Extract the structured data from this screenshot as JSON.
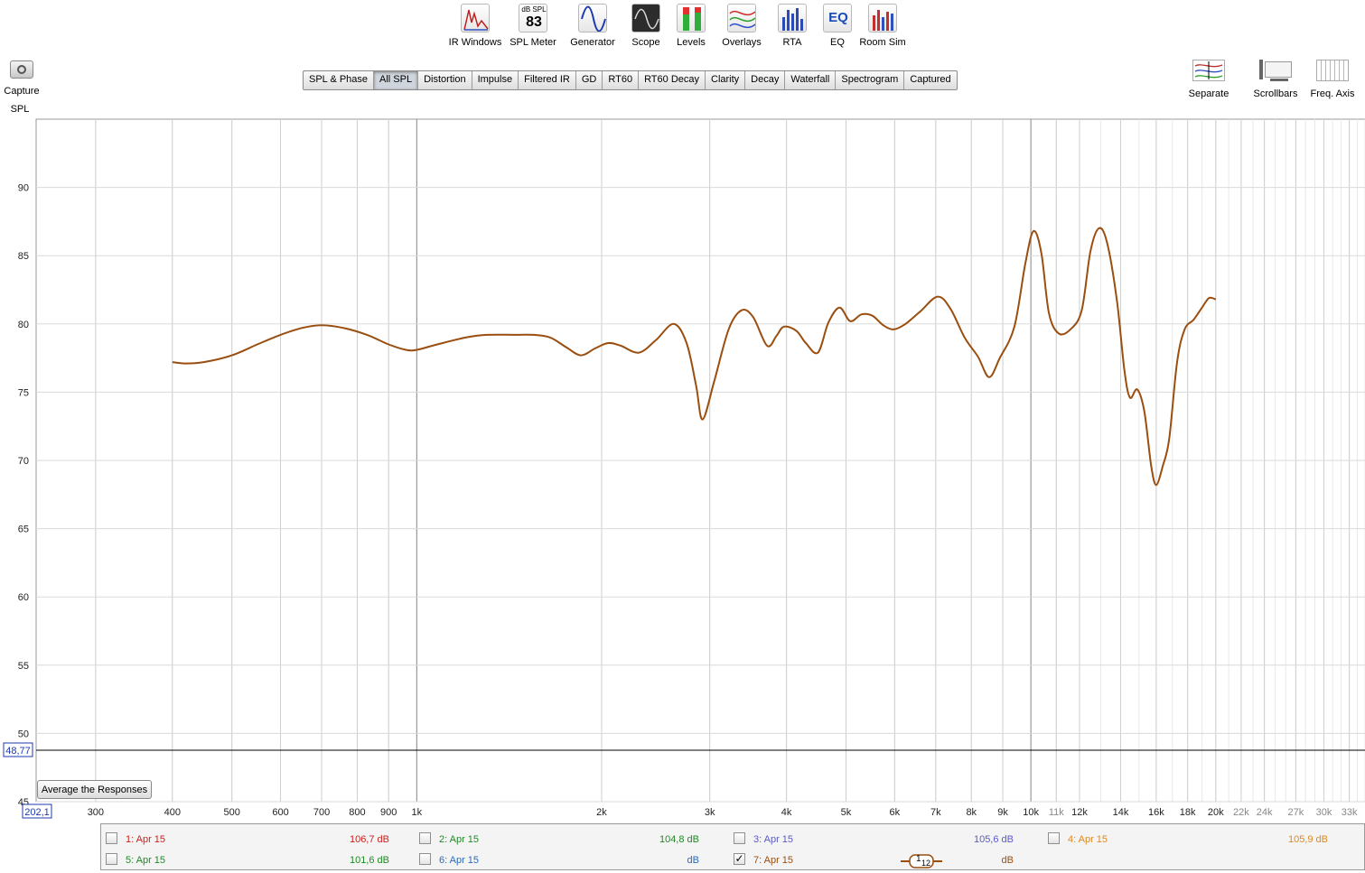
{
  "toolbar": {
    "items": [
      {
        "label": "IR Windows",
        "icon": "ir-windows-icon"
      },
      {
        "label": "SPL Meter",
        "icon": "spl-meter-icon",
        "meter_unit": "dB SPL",
        "meter_value": "83"
      },
      {
        "label": "Generator",
        "icon": "generator-icon"
      },
      {
        "label": "Scope",
        "icon": "scope-icon"
      },
      {
        "label": "Levels",
        "icon": "levels-icon"
      },
      {
        "label": "Overlays",
        "icon": "overlays-icon"
      },
      {
        "label": "RTA",
        "icon": "rta-icon"
      },
      {
        "label": "EQ",
        "icon": "eq-icon"
      },
      {
        "label": "Room Sim",
        "icon": "room-sim-icon"
      }
    ]
  },
  "capture": {
    "label": "Capture",
    "icon": "camera-icon"
  },
  "tabs": [
    {
      "label": "SPL & Phase",
      "active": false
    },
    {
      "label": "All SPL",
      "active": true
    },
    {
      "label": "Distortion",
      "active": false
    },
    {
      "label": "Impulse",
      "active": false
    },
    {
      "label": "Filtered IR",
      "active": false
    },
    {
      "label": "GD",
      "active": false
    },
    {
      "label": "RT60",
      "active": false
    },
    {
      "label": "RT60 Decay",
      "active": false
    },
    {
      "label": "Clarity",
      "active": false
    },
    {
      "label": "Decay",
      "active": false
    },
    {
      "label": "Waterfall",
      "active": false
    },
    {
      "label": "Spectrogram",
      "active": false
    },
    {
      "label": "Captured",
      "active": false
    }
  ],
  "right_tools": [
    {
      "label": "Separate",
      "icon": "separate-icon"
    },
    {
      "label": "Scrollbars",
      "icon": "scrollbars-icon"
    },
    {
      "label": "Freq. Axis",
      "icon": "freq-axis-icon"
    }
  ],
  "average_button": "Average the Responses",
  "cursor_readouts": {
    "y": "48,77",
    "x": "202,1"
  },
  "chart_data": {
    "type": "line",
    "ylabel": "SPL",
    "x_scale": "log",
    "xlim": [
      240,
      35000
    ],
    "ylim": [
      45,
      95
    ],
    "grid": true,
    "yticks": [
      45,
      50,
      55,
      60,
      65,
      70,
      75,
      80,
      85,
      90
    ],
    "xticks": [
      {
        "v": 300,
        "l": "300"
      },
      {
        "v": 400,
        "l": "400"
      },
      {
        "v": 500,
        "l": "500"
      },
      {
        "v": 600,
        "l": "600"
      },
      {
        "v": 700,
        "l": "700"
      },
      {
        "v": 800,
        "l": "800"
      },
      {
        "v": 900,
        "l": "900"
      },
      {
        "v": 1000,
        "l": "1k"
      },
      {
        "v": 2000,
        "l": "2k"
      },
      {
        "v": 3000,
        "l": "3k"
      },
      {
        "v": 4000,
        "l": "4k"
      },
      {
        "v": 5000,
        "l": "5k"
      },
      {
        "v": 6000,
        "l": "6k"
      },
      {
        "v": 7000,
        "l": "7k"
      },
      {
        "v": 8000,
        "l": "8k"
      },
      {
        "v": 9000,
        "l": "9k"
      },
      {
        "v": 10000,
        "l": "10k"
      },
      {
        "v": 11000,
        "l": "11k"
      },
      {
        "v": 12000,
        "l": "12k"
      },
      {
        "v": 14000,
        "l": "14k"
      },
      {
        "v": 16000,
        "l": "16k"
      },
      {
        "v": 18000,
        "l": "18k"
      },
      {
        "v": 20000,
        "l": "20k"
      },
      {
        "v": 22000,
        "l": "22k"
      },
      {
        "v": 24000,
        "l": "24k"
      },
      {
        "v": 27000,
        "l": "27k"
      },
      {
        "v": 30000,
        "l": "30k"
      },
      {
        "v": 33000,
        "l": "33k"
      }
    ],
    "cursor_level": 48.77,
    "series": [
      {
        "name": "7: Apr 15",
        "color": "#9a4e10",
        "points": [
          [
            400,
            77.2
          ],
          [
            420,
            77.1
          ],
          [
            450,
            77.2
          ],
          [
            500,
            77.7
          ],
          [
            550,
            78.5
          ],
          [
            600,
            79.2
          ],
          [
            650,
            79.7
          ],
          [
            700,
            79.9
          ],
          [
            760,
            79.7
          ],
          [
            830,
            79.2
          ],
          [
            900,
            78.5
          ],
          [
            960,
            78.1
          ],
          [
            1000,
            78.1
          ],
          [
            1080,
            78.5
          ],
          [
            1200,
            79.0
          ],
          [
            1300,
            79.2
          ],
          [
            1450,
            79.2
          ],
          [
            1550,
            79.2
          ],
          [
            1650,
            79.0
          ],
          [
            1750,
            78.3
          ],
          [
            1850,
            77.7
          ],
          [
            1950,
            78.2
          ],
          [
            2050,
            78.6
          ],
          [
            2150,
            78.4
          ],
          [
            2300,
            77.9
          ],
          [
            2450,
            78.8
          ],
          [
            2620,
            80.0
          ],
          [
            2750,
            78.6
          ],
          [
            2850,
            75.5
          ],
          [
            2920,
            73.0
          ],
          [
            3050,
            75.8
          ],
          [
            3220,
            79.6
          ],
          [
            3380,
            81.0
          ],
          [
            3530,
            80.5
          ],
          [
            3720,
            78.4
          ],
          [
            3850,
            79.1
          ],
          [
            3960,
            79.8
          ],
          [
            4150,
            79.5
          ],
          [
            4300,
            78.6
          ],
          [
            4500,
            77.9
          ],
          [
            4680,
            80.1
          ],
          [
            4880,
            81.2
          ],
          [
            5080,
            80.2
          ],
          [
            5300,
            80.7
          ],
          [
            5520,
            80.6
          ],
          [
            5750,
            79.9
          ],
          [
            5980,
            79.6
          ],
          [
            6250,
            80.0
          ],
          [
            6600,
            80.9
          ],
          [
            7050,
            82.0
          ],
          [
            7400,
            81.1
          ],
          [
            7800,
            79.0
          ],
          [
            8200,
            77.6
          ],
          [
            8550,
            76.1
          ],
          [
            8900,
            77.5
          ],
          [
            9400,
            79.8
          ],
          [
            9800,
            84.5
          ],
          [
            10100,
            86.8
          ],
          [
            10400,
            85.2
          ],
          [
            10700,
            80.8
          ],
          [
            11100,
            79.3
          ],
          [
            11600,
            79.6
          ],
          [
            12100,
            81.0
          ],
          [
            12500,
            85.3
          ],
          [
            12900,
            87.0
          ],
          [
            13300,
            86.0
          ],
          [
            13800,
            81.8
          ],
          [
            14200,
            76.6
          ],
          [
            14500,
            74.6
          ],
          [
            14900,
            75.2
          ],
          [
            15300,
            73.6
          ],
          [
            15700,
            69.6
          ],
          [
            16000,
            68.2
          ],
          [
            16400,
            69.6
          ],
          [
            16800,
            71.6
          ],
          [
            17300,
            77.2
          ],
          [
            17800,
            79.6
          ],
          [
            18400,
            80.3
          ],
          [
            19000,
            81.2
          ],
          [
            19500,
            81.9
          ],
          [
            20000,
            81.8
          ]
        ]
      }
    ]
  },
  "legend": [
    {
      "label": "1: Apr 15",
      "value": "106,7 dB",
      "color": "#c8221e",
      "checked": false
    },
    {
      "label": "2: Apr 15",
      "value": "104,8 dB",
      "color": "#1f8a24",
      "checked": false
    },
    {
      "label": "3: Apr 15",
      "value": "105,6 dB",
      "color": "#5a5ac8",
      "checked": false
    },
    {
      "label": "4: Apr 15",
      "value": "105,9 dB",
      "color": "#e0891e",
      "checked": false
    },
    {
      "label": "5: Apr 15",
      "value": "101,6 dB",
      "color": "#1f8a24",
      "checked": false
    },
    {
      "label": "6: Apr 15",
      "value": "dB",
      "color": "#2a6ab8",
      "checked": false
    },
    {
      "label": "7: Apr 15",
      "value": "dB",
      "color": "#9a4e10",
      "checked": true
    }
  ],
  "smoothing": {
    "num": "1",
    "den": "12"
  }
}
